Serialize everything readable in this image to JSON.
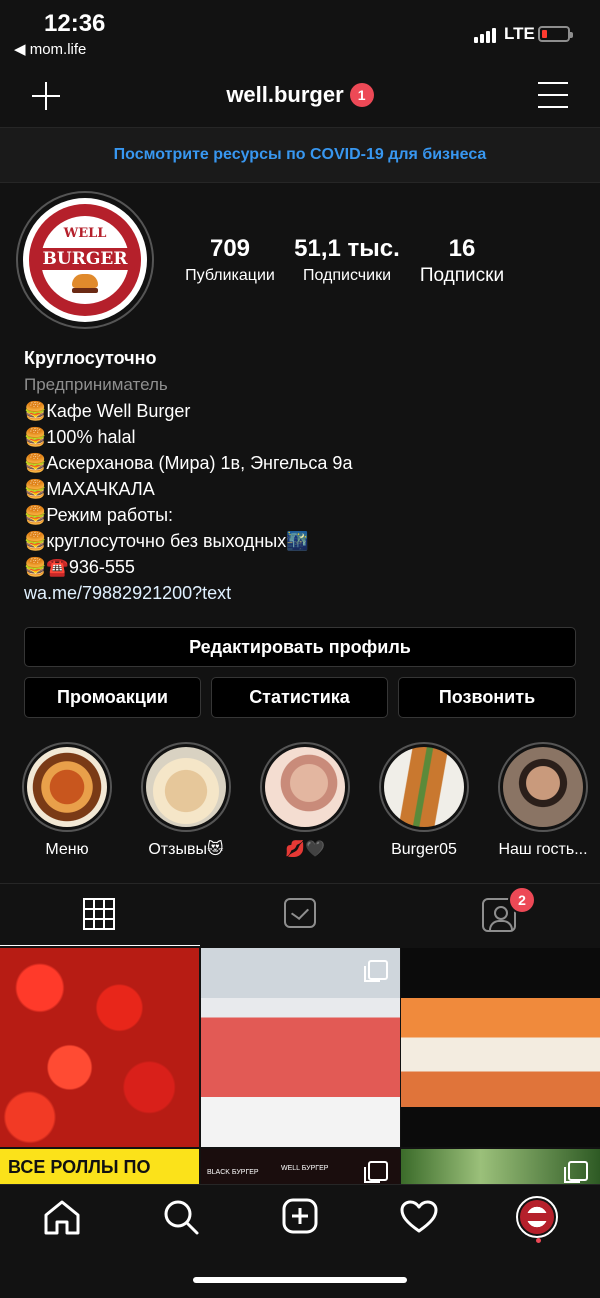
{
  "status_bar": {
    "time": "12:36",
    "back_app": "◀ mom.life",
    "network": "LTE"
  },
  "header": {
    "username": "well.burger",
    "notification_count": "1"
  },
  "covid_banner": "Посмотрите ресурсы по COVID-19 для бизнеса",
  "avatar": {
    "logo_top": "WELL",
    "logo_main": "BURGER"
  },
  "stats": [
    {
      "value": "709",
      "label": "Публикации"
    },
    {
      "value": "51,1 тыс.",
      "label": "Подписчики"
    },
    {
      "value": "16",
      "label": "Подписки"
    }
  ],
  "bio": {
    "name": "Круглосуточно",
    "category": "Предприниматель",
    "lines": [
      "🍔Кафе Well Burger",
      "🍔100% halal",
      "🍔Аскерханова (Мира) 1в, Энгельса 9а",
      "🍔МАХАЧКАЛА",
      "🍔Режим работы:",
      "🍔круглосуточно без выходных🌃",
      "🍔☎️936-555"
    ],
    "link": "wa.me/79882921200?text"
  },
  "buttons": {
    "edit_profile": "Редактировать профиль",
    "promotions": "Промоакции",
    "statistics": "Статистика",
    "call": "Позвонить"
  },
  "highlights": [
    {
      "label": "Меню"
    },
    {
      "label": "Отзывы😻"
    },
    {
      "label": "💋🖤"
    },
    {
      "label": "Burger05"
    },
    {
      "label": "Наш гость..."
    }
  ],
  "tabs": {
    "tagged_count": "2"
  },
  "posts_row2": {
    "promo_text": "ВСЕ РОЛЛЫ ПО",
    "post2_text": "BLACK БУРГЕР",
    "post2_text_b": "WELL БУРГЕР"
  },
  "colors": {
    "accent": "#3897f0",
    "badge": "#ed4956",
    "brand": "#b5202b"
  }
}
